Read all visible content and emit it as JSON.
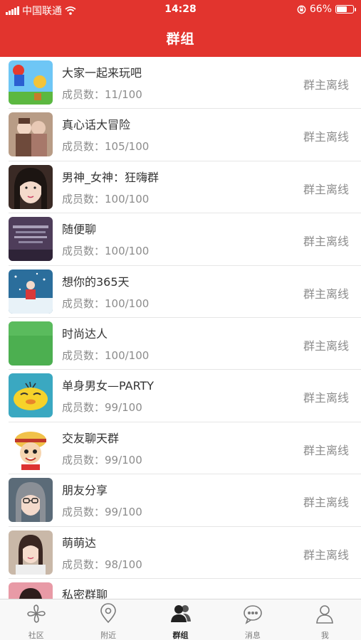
{
  "status_bar": {
    "carrier": "中国联通",
    "time": "14:28",
    "battery": "66%",
    "battery_level": 0.66
  },
  "header": {
    "title": "群组"
  },
  "groups": [
    {
      "name": "大家一起来玩吧",
      "members": "成员数：11/100",
      "status": "群主离线",
      "avatar": "game-avatar"
    },
    {
      "name": "真心话大冒险",
      "members": "成员数：105/100",
      "status": "群主离线",
      "avatar": "friends-photo-avatar"
    },
    {
      "name": "男神_女神：狂嗨群",
      "members": "成员数：100/100",
      "status": "群主离线",
      "avatar": "girl-portrait-avatar"
    },
    {
      "name": "随便聊",
      "members": "成员数：100/100",
      "status": "群主离线",
      "avatar": "purple-text-avatar"
    },
    {
      "name": "想你的365天",
      "members": "成员数：100/100",
      "status": "群主离线",
      "avatar": "snow-scene-avatar"
    },
    {
      "name": "时尚达人",
      "members": "成员数：100/100",
      "status": "群主离线",
      "avatar": "green-avatar"
    },
    {
      "name": "单身男女—PARTY",
      "members": "成员数：99/100",
      "status": "群主离线",
      "avatar": "yellow-bird-avatar"
    },
    {
      "name": "交友聊天群",
      "members": "成员数：99/100",
      "status": "群主离线",
      "avatar": "cartoon-boy-avatar"
    },
    {
      "name": "朋友分享",
      "members": "成员数：99/100",
      "status": "群主离线",
      "avatar": "glasses-girl-avatar"
    },
    {
      "name": "萌萌达",
      "members": "成员数：98/100",
      "status": "群主离线",
      "avatar": "girl-photo-avatar"
    },
    {
      "name": "私密群聊",
      "members": "",
      "status": "",
      "avatar": "pink-girl-avatar"
    }
  ],
  "tabs": [
    {
      "label": "社区",
      "icon": "pinwheel-icon",
      "active": false
    },
    {
      "label": "附近",
      "icon": "location-pin-icon",
      "active": false
    },
    {
      "label": "群组",
      "icon": "group-people-icon",
      "active": true
    },
    {
      "label": "消息",
      "icon": "chat-bubble-icon",
      "active": false
    },
    {
      "label": "我",
      "icon": "person-icon",
      "active": false
    }
  ],
  "colors": {
    "header_red": "#e2342e",
    "text_dark": "#333333",
    "text_gray": "#8c8c8c"
  }
}
